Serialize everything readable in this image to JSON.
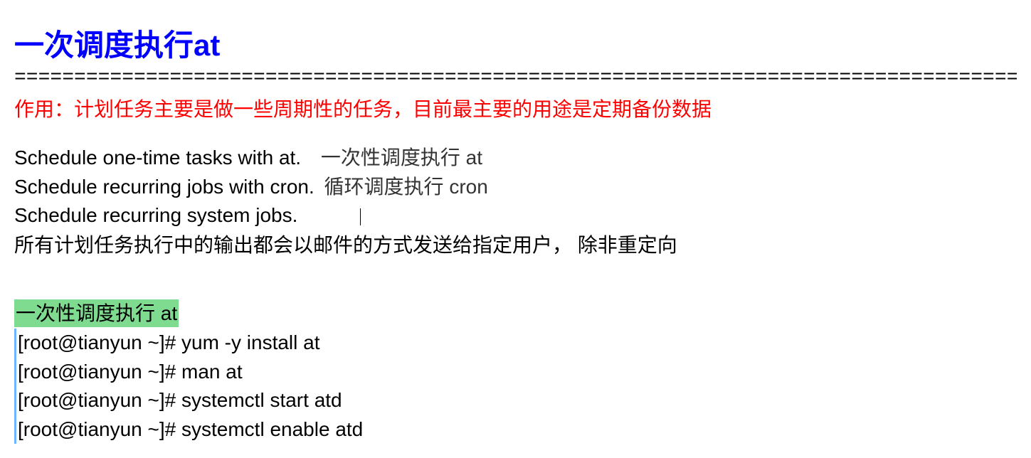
{
  "title": {
    "cn": "一次调度执行",
    "en": "at"
  },
  "divider": "=====================================================================================================",
  "purpose": "作用：计划任务主要是做一些周期性的任务，目前最主要的用途是定期备份数据",
  "schedule": {
    "line1_en": "Schedule one-time tasks with at.",
    "line1_cn": "一次性调度执行 at",
    "line2_en": "Schedule recurring jobs with cron.",
    "line2_cn": "循环调度执行 cron",
    "line3_en": "Schedule recurring system jobs."
  },
  "note": "所有计划任务执行中的输出都会以邮件的方式发送给指定用户， 除非重定向",
  "section_heading": "一次性调度执行 at",
  "commands": {
    "c1": "[root@tianyun ~]# yum -y install at",
    "c2": "[root@tianyun ~]# man at",
    "c3": "[root@tianyun ~]# systemctl start atd",
    "c4": "[root@tianyun ~]# systemctl enable atd"
  }
}
